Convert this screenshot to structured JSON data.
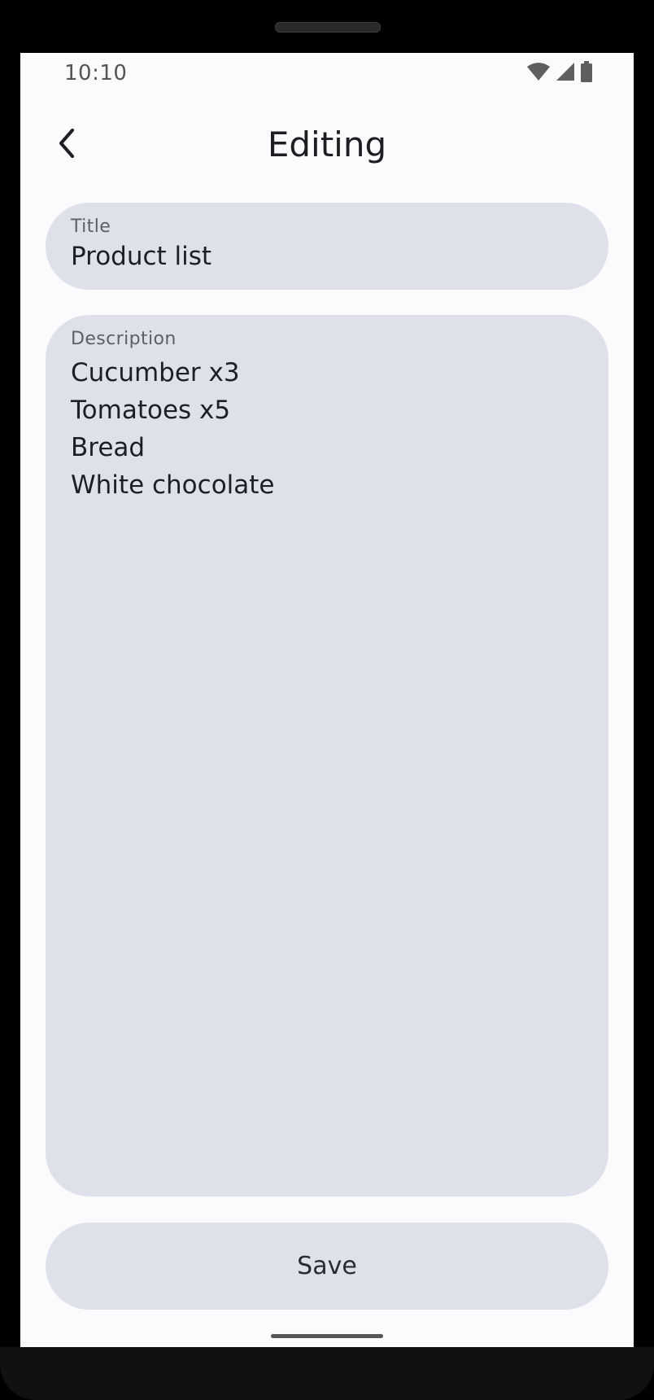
{
  "status_bar": {
    "time": "10:10",
    "icons": [
      "wifi-icon",
      "cellular-signal-icon",
      "battery-icon"
    ]
  },
  "top_bar": {
    "back_icon": "chevron-left-icon",
    "title": "Editing"
  },
  "form": {
    "title_field": {
      "label": "Title",
      "value": "Product list"
    },
    "description_field": {
      "label": "Description",
      "lines": [
        "Cucumber x3",
        "Tomatoes x5",
        "Bread",
        "White chocolate"
      ]
    }
  },
  "actions": {
    "save_label": "Save"
  },
  "colors": {
    "screen_background": "#fbfbfd",
    "field_background": "#dfe1ea",
    "text_primary": "#1d1e26",
    "text_label": "#5d5f68"
  }
}
